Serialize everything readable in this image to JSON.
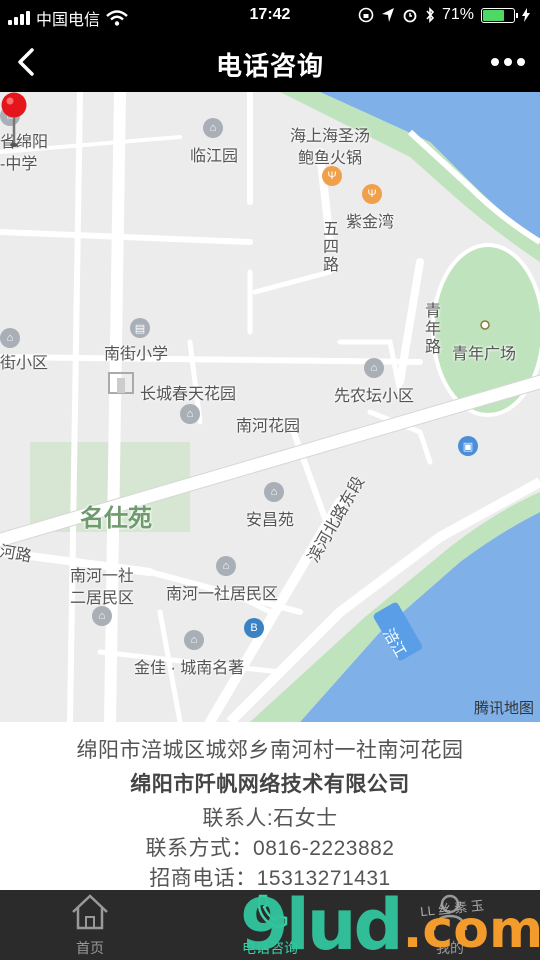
{
  "status_bar": {
    "carrier": "中国电信",
    "time": "17:42",
    "battery_percent": "71%",
    "battery_level": 0.71
  },
  "nav": {
    "title": "电话咨询"
  },
  "map": {
    "labels": {
      "l_shengmianyang": "省绵阳",
      "l_zhongxue": "-中学",
      "l_linjiangyuan": "临江园",
      "l_haishang": "海上海圣汤",
      "l_baoyu": "鲍鱼火锅",
      "l_zijinwan": "紫金湾",
      "l_wusilu": "五四路",
      "l_qingnianlu": "青年路",
      "l_qingnianguangchang": "青年广场",
      "l_xiaoqu": "街小区",
      "l_nanjie": "南街小学",
      "l_changcheng": "长城春天花园",
      "l_xiannongtan": "先农坛小区",
      "l_nanhehuayuan": "南河花园",
      "l_mingshiyuan": "名仕苑",
      "l_anchangyuan": "安昌苑",
      "l_binhe": "滨河北路东段",
      "l_lu": "河路",
      "l_nanheyishe_er": "南河一社",
      "l_erjumin": "二居民区",
      "l_nanheyishe_jumin": "南河一社居民区",
      "l_jinjia": "金佳 · 城南名著",
      "l_fujiang": "涪江",
      "l_tencent": "腾讯地图"
    }
  },
  "info": {
    "address": "绵阳市涪城区城郊乡南河村一社南河花园",
    "company": "绵阳市阡帆网络技术有限公司",
    "contact": "联系人:石女士",
    "phone": "联系方式：0816-2223882",
    "hotline": "招商电话：15313271431"
  },
  "tabs": [
    {
      "label": "首页",
      "icon": "home-icon",
      "active": false
    },
    {
      "label": "电话咨询",
      "icon": "phone-icon",
      "active": true
    },
    {
      "label": "我的",
      "icon": "user-icon",
      "active": false
    }
  ],
  "watermark": {
    "brand_a": "9lud",
    "brand_b": ".com",
    "small": "LL 丝 素 玉"
  },
  "colors": {
    "accent": "#3ad1a6",
    "river": "#7fb0e8",
    "park": "#bfe3bd",
    "pin": "#e4161b"
  }
}
